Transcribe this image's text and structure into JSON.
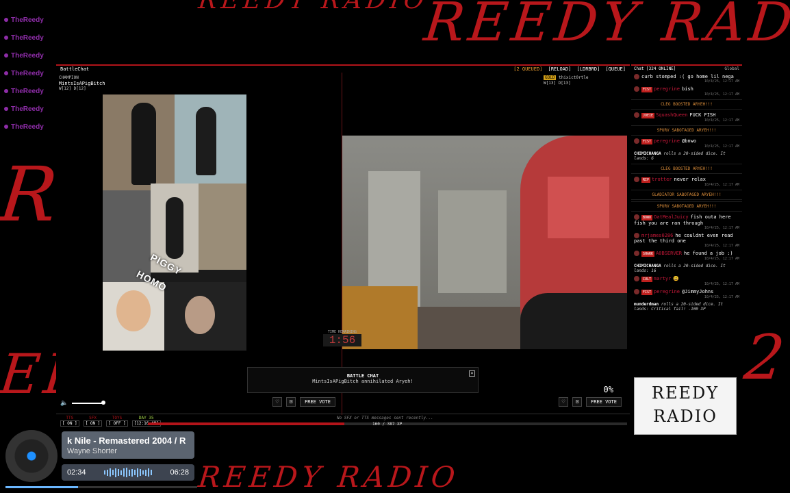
{
  "background": {
    "accent": "#c8191e"
  },
  "sidebar_names": [
    "TheReedy",
    "TheReedy",
    "TheReedy",
    "TheReedy",
    "TheReedy",
    "TheReedy",
    "TheReedy"
  ],
  "battle": {
    "title": "BattleChat",
    "queued": "[2 QUEUED]",
    "reload": "[RELOAD]",
    "ldrbrd": "[LDRBRD]",
    "queue": "[QUEUE]",
    "champion_label": "CHAMPION",
    "champion_name": "MintsIsAPigBitch",
    "champion_stats": "W[12] D[12]",
    "opponent_name": "thixict0rtle",
    "opponent_badge": "GOLD",
    "opponent_stats": "W[13] D[13]",
    "collage_label_1": "PIGGY",
    "collage_label_2": "HOMO",
    "timer_label": "TIME REMAINING",
    "timer": "1:56",
    "toast_title": "BATTLE CHAT",
    "toast_message": "MintsIsAPigBitch annihilated Aryeh!",
    "percent": "0%",
    "free_vote": "FREE VOTE"
  },
  "status": {
    "tts_label": "TTS",
    "tts_value": "[ ON ]",
    "sfx_label": "SFX",
    "sfx_value": "[ ON ]",
    "toys_label": "TOYS",
    "toys_value": "[ OFF ]",
    "day_label": "DAY 35",
    "clock": "[12:16 AM]",
    "nosfx": "No SFX or TTS messages sent recently...",
    "xp_text": "160 / 387 XP",
    "xp_fraction": 0.41
  },
  "chat": {
    "title": "Chat [324 ONLINE]",
    "scope": "Global",
    "messages": [
      {
        "kind": "msg",
        "badge": "",
        "user": "",
        "text": "curb stomped :( go home lil nega",
        "ts": "10/4/25, 12:17 AM"
      },
      {
        "kind": "msg",
        "badge": "FIST",
        "user": "peregrine",
        "text": "bish",
        "ts": "10/4/25, 12:17 AM"
      },
      {
        "kind": "sys",
        "text": "CLEG BOOSTED ARYEH!!!"
      },
      {
        "kind": "msg",
        "badge": "JOEIE",
        "user": "SquashQueen",
        "text": "FUCK FISH",
        "ts": "10/4/25, 12:17 AM"
      },
      {
        "kind": "sys",
        "text": "SPURV SABOTAGED ARYEH!!!"
      },
      {
        "kind": "msg",
        "badge": "FIST",
        "user": "peregrine",
        "text": "@bnwo",
        "ts": "10/4/25, 12:17 AM"
      },
      {
        "kind": "roll",
        "user": "CHIMICHANGA",
        "text": "rolls a 20-sided dice. It lands: 6"
      },
      {
        "kind": "sys",
        "text": "CLEG BOOSTED ARYEH!!!"
      },
      {
        "kind": "msg",
        "badge": "RIP",
        "user": "trotter",
        "text": "never relax",
        "ts": "10/4/25, 12:17 AM"
      },
      {
        "kind": "sys",
        "text": "GLADIATOR SABOTAGED ARYEH!!!"
      },
      {
        "kind": "sys",
        "text": "SPURV SABOTAGED ARYEH!!!"
      },
      {
        "kind": "msg",
        "badge": "BOWO",
        "user": "OatMealJuicy",
        "text": "fish outa here fish you are ran through",
        "ts": "10/4/25, 12:17 AM"
      },
      {
        "kind": "msg",
        "badge": "",
        "user": "mrjames0286",
        "text": "he couldnt even read past the third one",
        "ts": "10/4/25, 12:17 AM"
      },
      {
        "kind": "msg",
        "badge": "SHARK",
        "user": "A0BSERVER",
        "text": "he found a job :)",
        "ts": "10/4/25, 12:17 AM"
      },
      {
        "kind": "roll",
        "user": "CHIMICHANGA",
        "text": "rolls a 20-sided dice. It lands: 16"
      },
      {
        "kind": "msg",
        "badge": "CULT",
        "user": "martyr",
        "text": "😀",
        "ts": "10/4/25, 12:17 AM"
      },
      {
        "kind": "msg",
        "badge": "FIST",
        "user": "peregrine",
        "text": "@JimmyJohns",
        "ts": "10/4/25, 12:17 AM"
      },
      {
        "kind": "roll",
        "user": "munderdman",
        "text": "rolls a 20-sided dice. It lands: Critical fail! -100 XP"
      }
    ]
  },
  "logo": {
    "line1": "REEDY",
    "line2": "RADIO"
  },
  "now_playing": {
    "song": "k Nile - Remastered 2004 / R",
    "artist": "Wayne Shorter",
    "elapsed": "02:34",
    "duration": "06:28",
    "progress_fraction": 0.38
  },
  "background_text": {
    "top": "REEDY RADIO",
    "bottom": "REEDY RADIO"
  }
}
